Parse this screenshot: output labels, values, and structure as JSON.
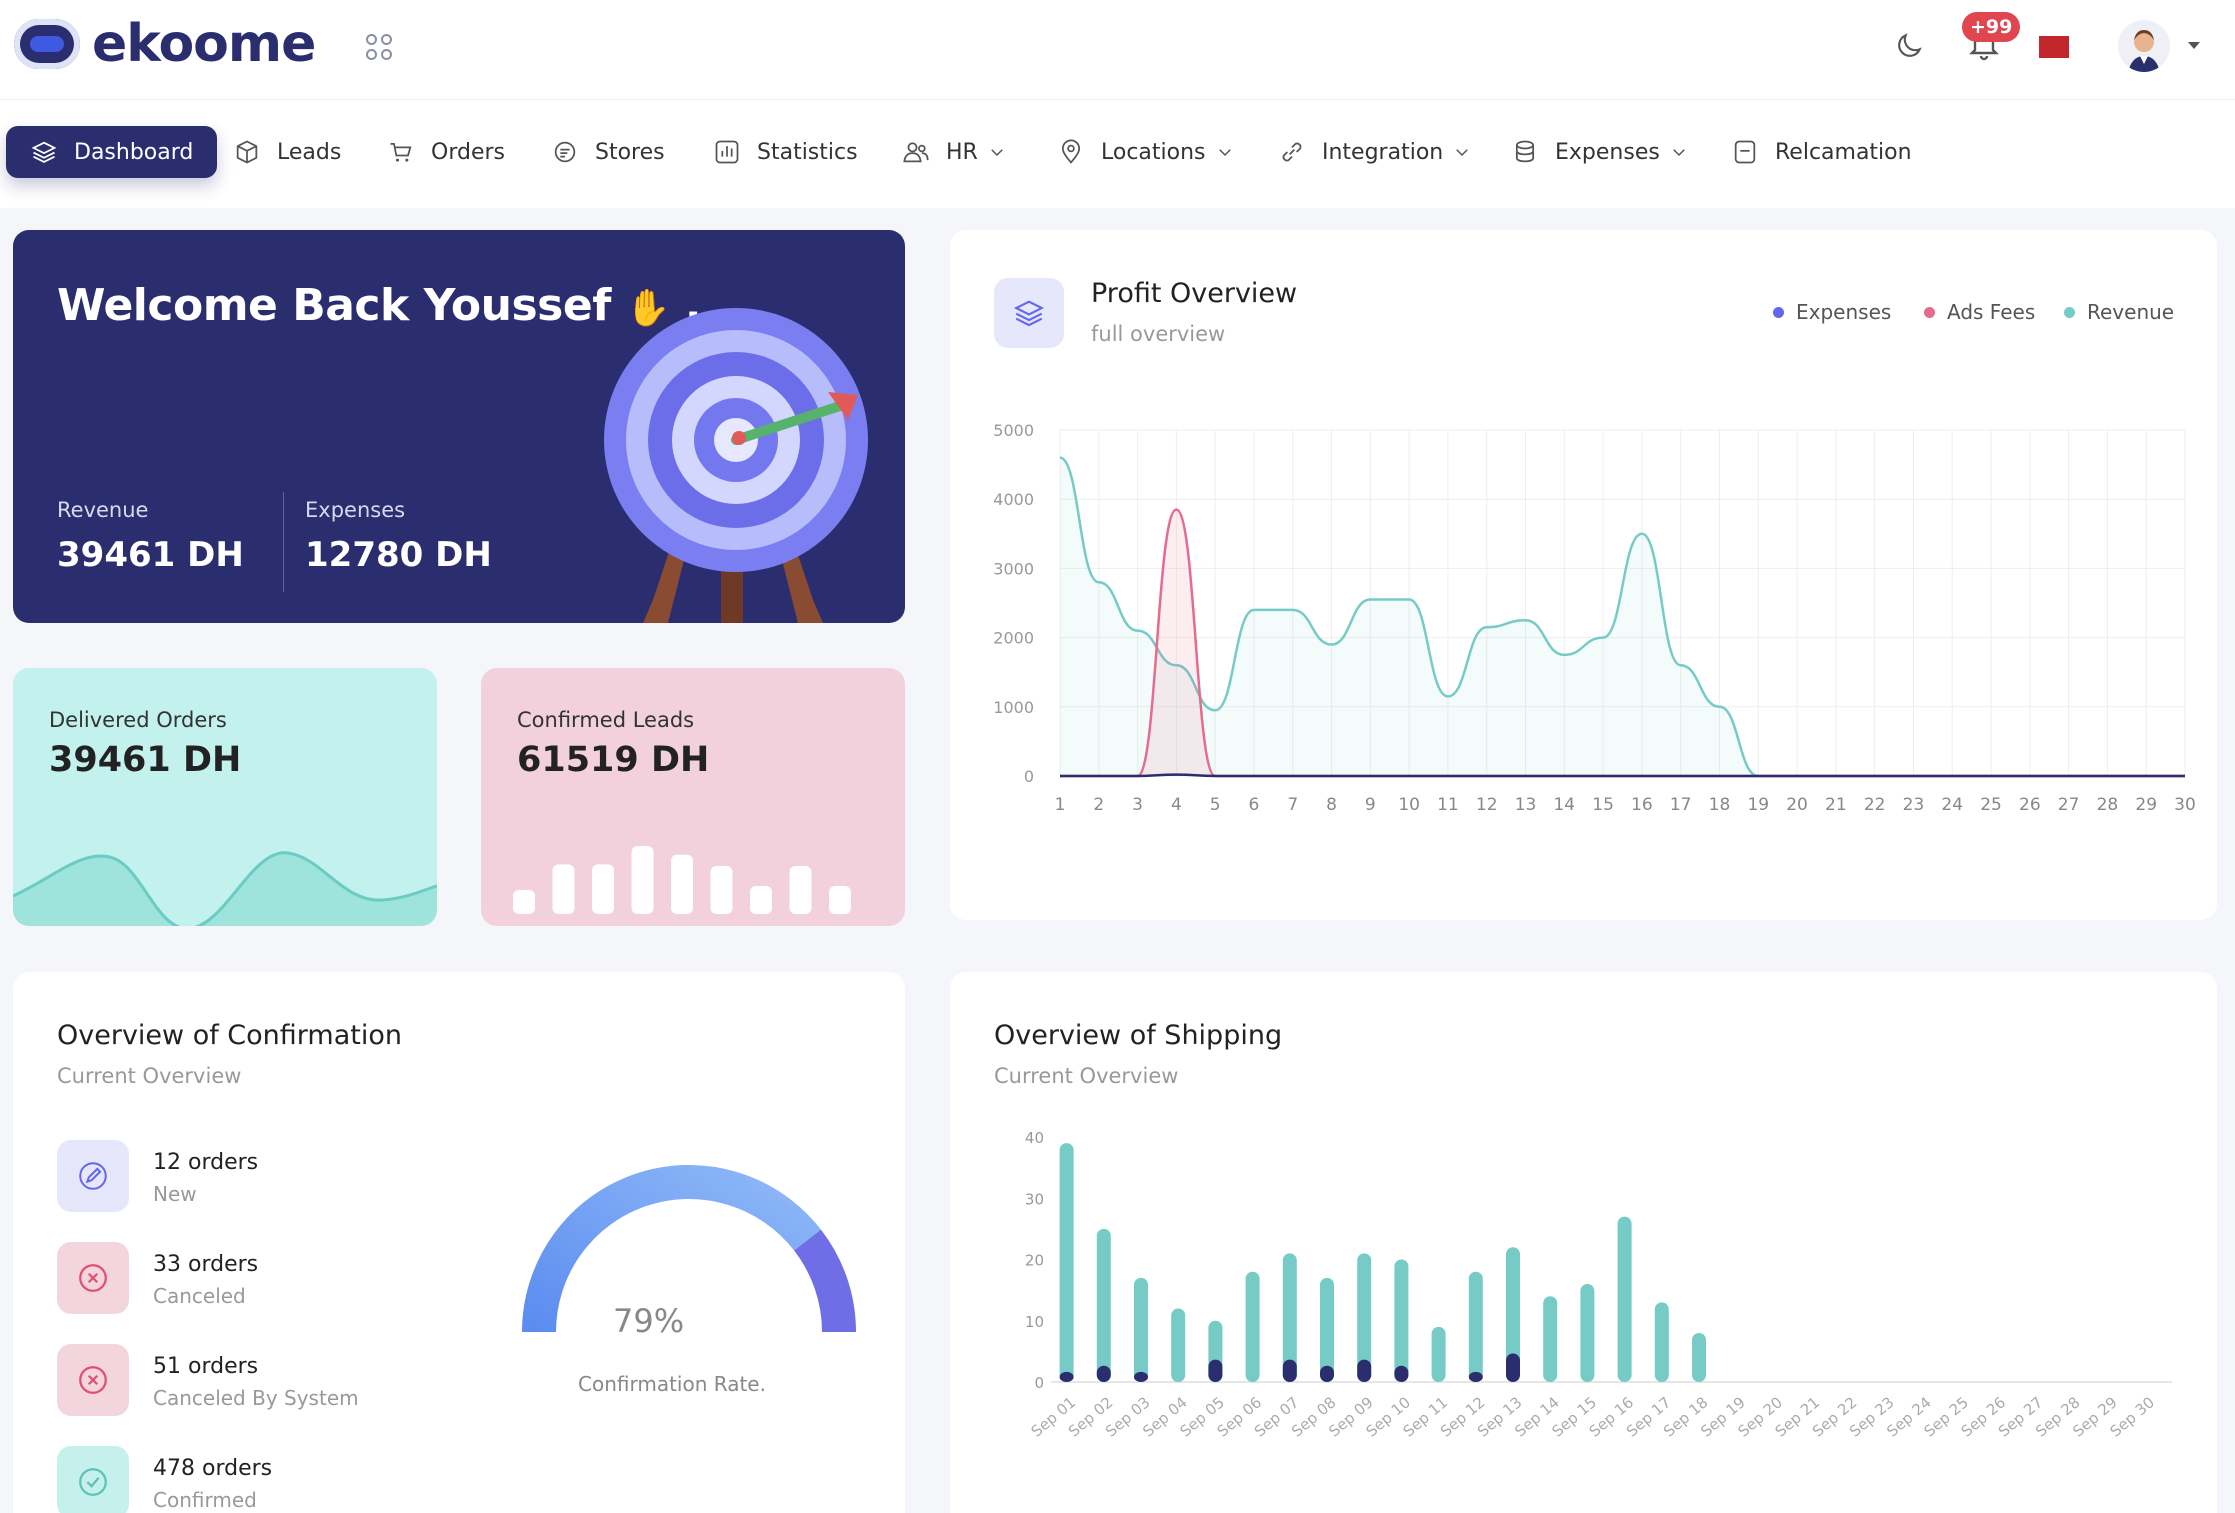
{
  "brand": {
    "name": "ekoome"
  },
  "header": {
    "notification_badge": "+99"
  },
  "nav": {
    "items": [
      {
        "label": "Dashboard",
        "icon": "layers-icon",
        "active": true
      },
      {
        "label": "Leads",
        "icon": "box-icon"
      },
      {
        "label": "Orders",
        "icon": "cart-icon"
      },
      {
        "label": "Stores",
        "icon": "store-icon"
      },
      {
        "label": "Statistics",
        "icon": "bar-chart-icon"
      },
      {
        "label": "HR",
        "icon": "users-icon",
        "dropdown": true
      },
      {
        "label": "Locations",
        "icon": "location-pin-icon",
        "dropdown": true
      },
      {
        "label": "Integration",
        "icon": "link-icon",
        "dropdown": true
      },
      {
        "label": "Expenses",
        "icon": "coins-icon",
        "dropdown": true
      },
      {
        "label": "Relcamation",
        "icon": "note-icon"
      }
    ]
  },
  "welcome": {
    "title": "Welcome Back Youssef",
    "suffix": ",",
    "revenue_label": "Revenue",
    "revenue_value": "39461 DH",
    "expenses_label": "Expenses",
    "expenses_value": "12780 DH"
  },
  "mini_cards": {
    "delivered": {
      "label": "Delivered Orders",
      "value": "39461 DH"
    },
    "confirmed": {
      "label": "Confirmed Leads",
      "value": "61519 DH",
      "bar_levels": [
        0.3,
        0.62,
        0.62,
        0.85,
        0.74,
        0.6,
        0.35,
        0.6,
        0.35
      ]
    }
  },
  "profit": {
    "title": "Profit Overview",
    "subtitle": "full overview",
    "legend": [
      {
        "label": "Expenses",
        "color": "#6366f1"
      },
      {
        "label": "Ads Fees",
        "color": "#e56b8f"
      },
      {
        "label": "Revenue",
        "color": "#76cbc6"
      }
    ]
  },
  "confirmation": {
    "title": "Overview of Confirmation",
    "subtitle": "Current Overview",
    "stats": [
      {
        "main": "12 orders",
        "sub": "New",
        "icon": "edit-icon"
      },
      {
        "main": "33 orders",
        "sub": "Canceled",
        "icon": "x-circle-icon"
      },
      {
        "main": "51 orders",
        "sub": "Canceled By System",
        "icon": "x-circle-icon"
      },
      {
        "main": "478 orders",
        "sub": "Confirmed",
        "icon": "check-circle-icon"
      }
    ],
    "rate_value": "79%",
    "rate_label": "Confirmation Rate."
  },
  "shipping": {
    "title": "Overview of Shipping",
    "subtitle": "Current Overview"
  },
  "chart_data": [
    {
      "type": "line",
      "title": "Profit Overview",
      "x": [
        1,
        2,
        3,
        4,
        5,
        6,
        7,
        8,
        9,
        10,
        11,
        12,
        13,
        14,
        15,
        16,
        17,
        18,
        19,
        20,
        21,
        22,
        23,
        24,
        25,
        26,
        27,
        28,
        29,
        30
      ],
      "ylim": [
        0,
        5000
      ],
      "yticks": [
        0,
        1000,
        2000,
        3000,
        4000,
        5000
      ],
      "grid": true,
      "legend_position": "top-right",
      "series": [
        {
          "name": "Revenue",
          "color": "#76cbc6",
          "values": [
            4600,
            2800,
            2100,
            1600,
            950,
            2400,
            2400,
            1900,
            2550,
            2550,
            1150,
            2150,
            2250,
            1750,
            2000,
            3500,
            1600,
            1000,
            0,
            0,
            0,
            0,
            0,
            0,
            0,
            0,
            0,
            0,
            0,
            0
          ]
        },
        {
          "name": "Ads Fees",
          "color": "#e56b8f",
          "values": [
            0,
            0,
            0,
            3850,
            0,
            0,
            0,
            0,
            0,
            0,
            0,
            0,
            0,
            0,
            0,
            0,
            0,
            0,
            0,
            0,
            0,
            0,
            0,
            0,
            0,
            0,
            0,
            0,
            0,
            0
          ]
        },
        {
          "name": "Expenses",
          "color": "#2b2e6e",
          "values": [
            0,
            0,
            0,
            20,
            0,
            0,
            0,
            0,
            0,
            0,
            0,
            0,
            0,
            0,
            0,
            0,
            0,
            0,
            0,
            0,
            0,
            0,
            0,
            0,
            0,
            0,
            0,
            0,
            0,
            0
          ]
        }
      ]
    },
    {
      "type": "bar",
      "title": "Overview of Shipping",
      "categories": [
        "Sep 01",
        "Sep 02",
        "Sep 03",
        "Sep 04",
        "Sep 05",
        "Sep 06",
        "Sep 07",
        "Sep 08",
        "Sep 09",
        "Sep 10",
        "Sep 11",
        "Sep 12",
        "Sep 13",
        "Sep 14",
        "Sep 15",
        "Sep 16",
        "Sep 17",
        "Sep 18",
        "Sep 19",
        "Sep 20",
        "Sep 21",
        "Sep 22",
        "Sep 23",
        "Sep 24",
        "Sep 25",
        "Sep 26",
        "Sep 27",
        "Sep 28",
        "Sep 29",
        "Sep 30"
      ],
      "ylim": [
        0,
        40
      ],
      "yticks": [
        0,
        10,
        20,
        30,
        40
      ],
      "series": [
        {
          "color": "#76cbc6",
          "values": [
            39,
            25,
            17,
            12,
            10,
            18,
            21,
            17,
            21,
            20,
            9,
            18,
            22,
            14,
            16,
            27,
            13,
            8,
            0,
            0,
            0,
            0,
            0,
            0,
            0,
            0,
            0,
            0,
            0,
            0
          ]
        },
        {
          "color": "#2b2e6e",
          "values": [
            1,
            2,
            1,
            0,
            3,
            0,
            3,
            2,
            3,
            2,
            0,
            1,
            4,
            0,
            0,
            0,
            0,
            0,
            0,
            0,
            0,
            0,
            0,
            0,
            0,
            0,
            0,
            0,
            0,
            0
          ]
        }
      ]
    },
    {
      "type": "gauge",
      "title": "Confirmation Rate.",
      "value": 79,
      "max": 100
    }
  ]
}
